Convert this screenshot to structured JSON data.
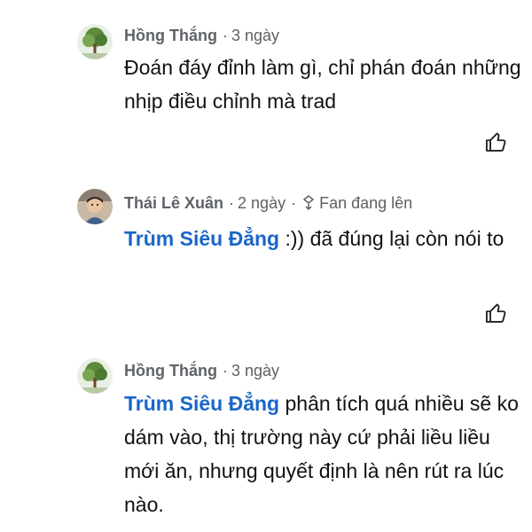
{
  "comments": [
    {
      "author": "Hồng Thắng",
      "time": "3 ngày",
      "text": "Đoán đáy đỉnh làm gì, chỉ phán đoán những nhịp điều chỉnh mà trad",
      "avatar_icon": "tree-avatar"
    },
    {
      "author": "Thái Lê Xuân",
      "time": "2 ngày",
      "badge": "Fan đang lên",
      "badge_icon": "rising-fan-icon",
      "mention": "Trùm Siêu Đẳng",
      "text": " :)) đã đúng lại còn nói to",
      "avatar_icon": "child-photo-avatar"
    },
    {
      "author": "Hồng Thắng",
      "time": "3 ngày",
      "mention": "Trùm Siêu Đẳng",
      "text": " phân tích quá nhiều sẽ ko dám vào, thị trường này cứ phải liều liều mới ăn, nhưng quyết định là nên rút ra lúc nào.",
      "avatar_icon": "tree-avatar"
    }
  ],
  "separator": "·",
  "like_icon": "thumbs-up-icon",
  "colors": {
    "mention": "#1a66c8",
    "meta": "#606060",
    "text": "#111111"
  }
}
